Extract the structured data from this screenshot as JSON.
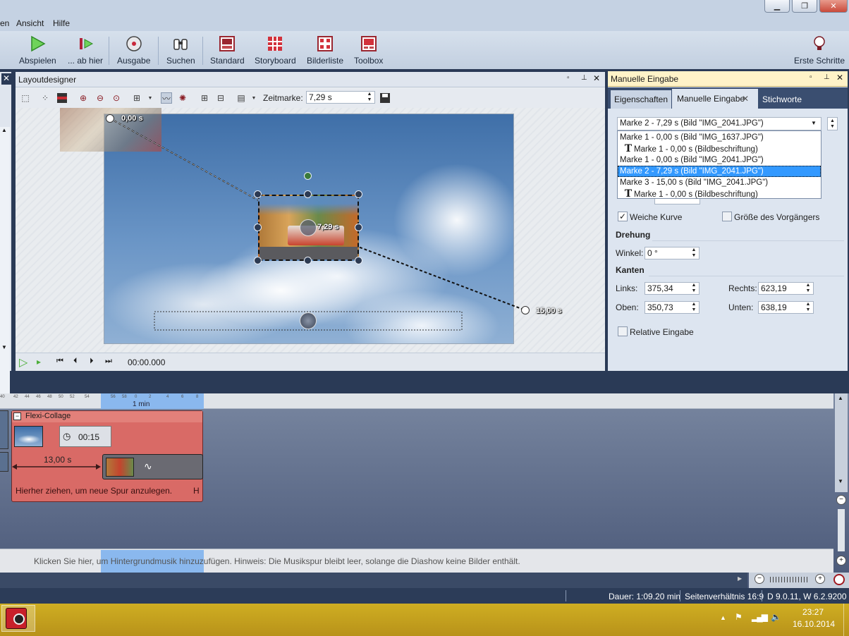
{
  "menu": {
    "items": [
      "en",
      "Ansicht",
      "Hilfe"
    ]
  },
  "window_controls": {
    "minimize": "▁",
    "restore": "❐",
    "close": "✕"
  },
  "toolbar": {
    "play": "Abspielen",
    "play_from_here": "... ab hier",
    "output": "Ausgabe",
    "search": "Suchen",
    "standard": "Standard",
    "storyboard": "Storyboard",
    "image_list": "Bilderliste",
    "toolbox": "Toolbox",
    "first_steps": "Erste Schritte"
  },
  "layout_designer": {
    "title": "Layoutdesigner",
    "zeitmarke_label": "Zeitmarke:",
    "zeitmarke_value": "7,29 s",
    "marker_start": "0,00 s",
    "marker_mid": "7,29 s",
    "marker_end": "15,00 s",
    "playback_time": "00:00.000"
  },
  "right_panel": {
    "title": "Manuelle Eingabe",
    "tabs": [
      "Eigenschaften",
      "Manuelle Eingabe",
      "Stichworte"
    ],
    "active_tab": 1,
    "dropdown_value": "Marke 2 - 7,29 s (Bild \"IMG_2041.JPG\")",
    "dropdown_items": [
      {
        "label": "Marke 1 - 0,00 s (Bild \"IMG_1637.JPG\")",
        "caption": false,
        "selected": false
      },
      {
        "label": "Marke 1 - 0,00 s (Bildbeschriftung)",
        "caption": true,
        "selected": false
      },
      {
        "label": "Marke 1 - 0,00 s (Bild \"IMG_2041.JPG\")",
        "caption": false,
        "selected": false
      },
      {
        "label": "Marke 2 - 7,29 s (Bild \"IMG_2041.JPG\")",
        "caption": false,
        "selected": true
      },
      {
        "label": "Marke 3 - 15,00 s (Bild \"IMG_2041.JPG\")",
        "caption": false,
        "selected": false
      },
      {
        "label": "Marke 1 - 0,00 s (Bildbeschriftung)",
        "caption": true,
        "selected": false
      }
    ],
    "weiche_kurve": "Weiche Kurve",
    "weiche_kurve_checked": true,
    "groesse_vorgaenger": "Größe des Vorgängers",
    "groesse_vorgaenger_checked": false,
    "drehung_heading": "Drehung",
    "winkel_label": "Winkel:",
    "winkel_value": "0 °",
    "kanten_heading": "Kanten",
    "links_label": "Links:",
    "links_value": "375,34",
    "rechts_label": "Rechts:",
    "rechts_value": "623,19",
    "oben_label": "Oben:",
    "oben_value": "350,73",
    "unten_label": "Unten:",
    "unten_value": "638,19",
    "relative_label": "Relative Eingabe",
    "relative_checked": false
  },
  "timeline": {
    "ticks": [
      "40",
      "42",
      "44",
      "46",
      "48",
      "50",
      "52",
      "54",
      "56",
      "58",
      "0",
      "2",
      "4",
      "6",
      "8"
    ],
    "minute_marker": "1 min",
    "collage_title": "Flexi-Collage",
    "clip_duration": "00:15",
    "transition_duration": "13,00 s",
    "drop_hint": "Hierher ziehen, um neue Spur anzulegen.",
    "drop_hint_suffix": "H",
    "music_hint": "Klicken Sie hier, um Hintergrundmusik hinzuzufügen. Hinweis: Die Musikspur bleibt leer, solange die Diashow keine Bilder enthält."
  },
  "statusbar": {
    "duration": "Dauer: 1:09.20 min",
    "aspect": "Seitenverhältnis 16:9",
    "version": "D 9.0.11, W 6.2.9200"
  },
  "taskbar": {
    "time": "23:27",
    "date": "16.10.2014"
  },
  "colors": {
    "panel_bg": "#dde5f0",
    "accent_blue": "#3399ff",
    "collage_red": "#d96a66",
    "taskbar": "#c8a418"
  }
}
